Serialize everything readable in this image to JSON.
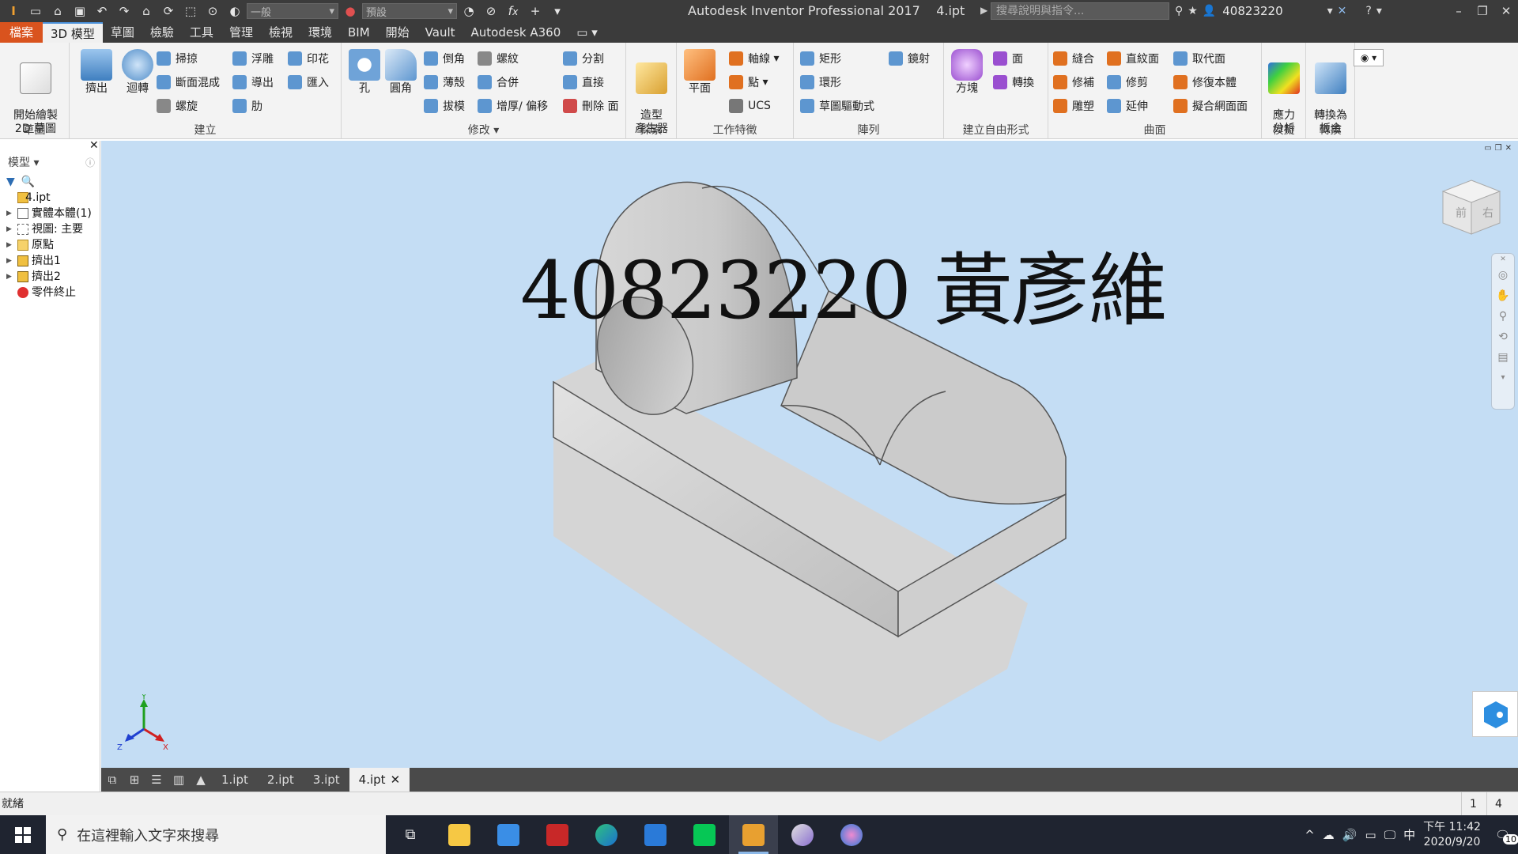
{
  "titlebar": {
    "title": "Autodesk Inventor Professional 2017",
    "document": "4.ipt",
    "material_combo": "一般",
    "appearance_combo": "預設",
    "search_placeholder": "搜尋說明與指令...",
    "user": "40823220"
  },
  "tabs": [
    "檔案",
    "3D 模型",
    "草圖",
    "檢驗",
    "工具",
    "管理",
    "檢視",
    "環境",
    "BIM",
    "開始",
    "Vault",
    "Autodesk A360"
  ],
  "ribbon": {
    "sketch": {
      "title": "草圖",
      "start_2d_sketch": "開始繪製\n2D 草圖"
    },
    "create": {
      "title": "建立",
      "extrude": "擠出",
      "revolve": "迴轉",
      "sweep": "掃掠",
      "loft": "斷面混成",
      "coil": "螺旋",
      "emboss": "浮雕",
      "derive": "導出",
      "rib": "肋",
      "decal": "印花",
      "import": "匯入"
    },
    "modify": {
      "title": "修改",
      "hole": "孔",
      "fillet": "圓角",
      "chamfer": "倒角",
      "shell": "薄殼",
      "draft": "拔模",
      "thread": "螺紋",
      "combine": "合併",
      "thicken": "增厚/ 偏移",
      "split": "分割",
      "direct": "直接",
      "delete_face": "刪除 面"
    },
    "explore": {
      "title": "探索",
      "shape_generator": "造型\n產生器"
    },
    "work_features": {
      "title": "工作特徵",
      "plane": "平面",
      "axis": "軸線",
      "point": "點",
      "ucs": "UCS"
    },
    "pattern": {
      "title": "陣列",
      "rectangular": "矩形",
      "circular": "環形",
      "sketch_driven": "草圖驅動式",
      "mirror": "鏡射"
    },
    "freeform": {
      "title": "建立自由形式",
      "box": "方塊",
      "face": "面",
      "convert": "轉換"
    },
    "surface": {
      "title": "曲面",
      "stitch": "縫合",
      "patch": "修補",
      "sculpt": "雕塑",
      "ruled": "直紋面",
      "trim": "修剪",
      "extend": "延伸",
      "replace_face": "取代面",
      "repair_bodies": "修復本體",
      "fit_mesh_face": "擬合網面面"
    },
    "simulation": {
      "title": "模擬",
      "stress_analysis": "應力\n分析"
    },
    "convert": {
      "title": "轉換",
      "to_sheet_metal": "轉換為\n板金"
    }
  },
  "browser": {
    "header": "模型",
    "items": [
      {
        "label": "4.ipt",
        "expander": false
      },
      {
        "label": "實體本體(1)",
        "expander": true
      },
      {
        "label": "視圖: 主要",
        "expander": true
      },
      {
        "label": "原點",
        "expander": true
      },
      {
        "label": "擠出1",
        "expander": true
      },
      {
        "label": "擠出2",
        "expander": true
      },
      {
        "label": "零件終止",
        "expander": false
      }
    ]
  },
  "viewport": {
    "overlay_text": "40823220 黃彥維",
    "viewcube_front": "前",
    "viewcube_right": "右",
    "triad_x": "X",
    "triad_y": "Y",
    "triad_z": "Z"
  },
  "doc_tabs": [
    "1.ipt",
    "2.ipt",
    "3.ipt",
    "4.ipt"
  ],
  "active_doc_tab": 3,
  "statusbar": {
    "text": "就緒",
    "n1": "1",
    "n2": "4"
  },
  "taskbar": {
    "search_placeholder": "在這裡輸入文字來搜尋",
    "clock_time": "下午 11:42",
    "clock_date": "2020/9/20",
    "ime": "中",
    "notifications": "10"
  },
  "colors": {
    "file_tab": "#d9531e",
    "viewport_bg": "#c4ddf4",
    "titlebar": "#3b3b3b",
    "taskbar": "#1f2430"
  }
}
